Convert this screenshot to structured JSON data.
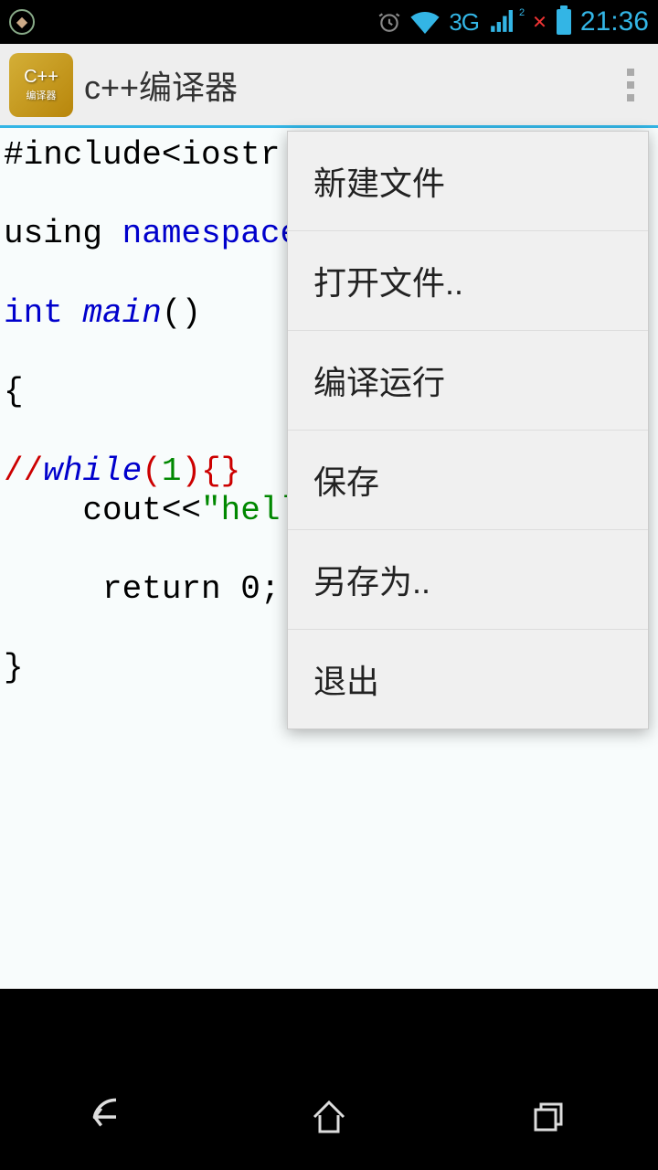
{
  "status_bar": {
    "network_label": "3G",
    "sim_slot": "2",
    "clock": "21:36"
  },
  "app_bar": {
    "icon_main": "C++",
    "icon_sub": "编译器",
    "title": "c++编译器"
  },
  "code": {
    "line1_pre": "#include<iostr",
    "line2_pre": "using ",
    "line2_kw": "namespace",
    "line3_kw": "int",
    "line3_fn": " main",
    "line3_post": "()",
    "line4": "{",
    "line5_cmt": "//",
    "line5_kw": "while",
    "line5_paren1": "(",
    "line5_num": "1",
    "line5_paren2": ")",
    "line5_brace": "{}",
    "line6_pre": "    cout<<",
    "line6_str": "\"hell",
    "line7": "     return 0;",
    "line8": "}"
  },
  "menu": {
    "items": [
      "新建文件",
      "打开文件..",
      "编译运行",
      "保存",
      "另存为..",
      "退出"
    ]
  }
}
